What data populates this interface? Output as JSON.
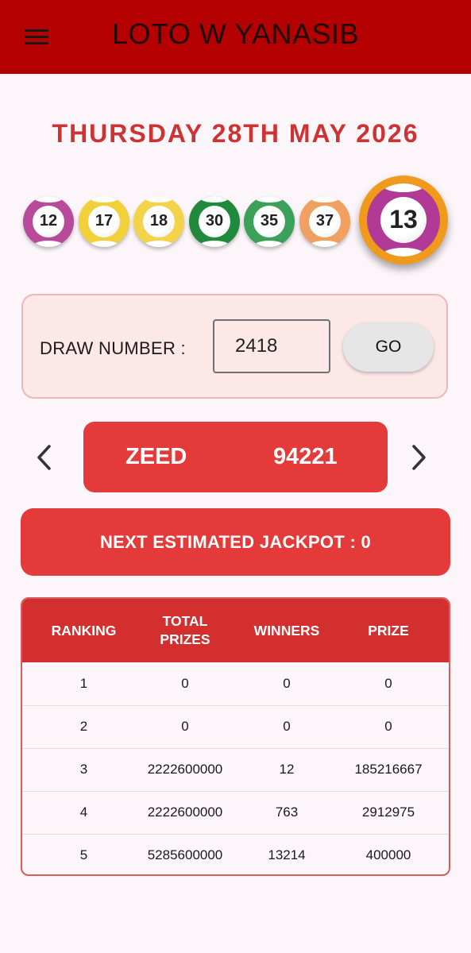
{
  "app": {
    "title": "LOTO W YANASIB"
  },
  "draw": {
    "date": "THURSDAY 28TH MAY 2026"
  },
  "balls": [
    {
      "number": "12",
      "color": "#b84a9c"
    },
    {
      "number": "17",
      "color": "#f1d03a"
    },
    {
      "number": "18",
      "color": "#f2d34a"
    },
    {
      "number": "30",
      "color": "#1f8a3c"
    },
    {
      "number": "35",
      "color": "#3aa05a"
    },
    {
      "number": "37",
      "color": "#f0a060"
    }
  ],
  "bonus_ball": {
    "number": "13",
    "color": "#b03a96",
    "ring_color": "#f09a1c"
  },
  "draw_form": {
    "label": "DRAW NUMBER :",
    "value": "2418",
    "go_label": "GO"
  },
  "zeed": {
    "label": "ZEED",
    "value": "94221"
  },
  "jackpot": {
    "text": "NEXT ESTIMATED JACKPOT : 0"
  },
  "prize_table": {
    "headers": [
      "RANKING",
      "TOTAL PRIZES",
      "WINNERS",
      "PRIZE"
    ],
    "rows": [
      [
        "1",
        "0",
        "0",
        "0"
      ],
      [
        "2",
        "0",
        "0",
        "0"
      ],
      [
        "3",
        "2222600000",
        "12",
        "185216667"
      ],
      [
        "4",
        "2222600000",
        "763",
        "2912975"
      ],
      [
        "5",
        "5285600000",
        "13214",
        "400000"
      ]
    ]
  },
  "icons": {
    "menu": "menu-icon",
    "prev": "chevron-left-icon",
    "next": "chevron-right-icon"
  },
  "colors": {
    "appbar": "#b40000",
    "accent": "#e43a3a",
    "date_text": "#cc3434",
    "panel_bg": "#fde8e8"
  }
}
